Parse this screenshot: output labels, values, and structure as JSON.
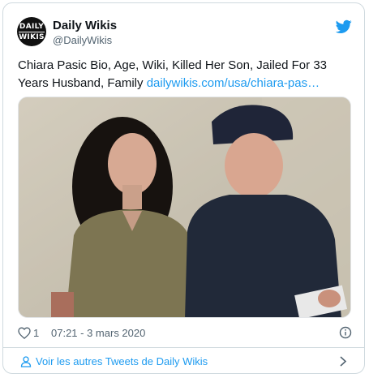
{
  "account": {
    "avatar_text_top": "DAILY",
    "avatar_text_bottom": "WIKIS",
    "display_name": "Daily Wikis",
    "handle": "@DailyWikis"
  },
  "tweet": {
    "text": "Chiara Pasic Bio, Age, Wiki, Killed Her Son, Jailed For 33 Years Husband, Family ",
    "link_text": "dailywikis.com/usa/chiara-pas…",
    "likes": "1",
    "timestamp": "07:21 - 3 mars 2020"
  },
  "footer": {
    "more_tweets_label": "Voir les autres Tweets de Daily Wikis"
  },
  "colors": {
    "accent": "#1d9bf0",
    "muted": "#536471",
    "border": "#cfd9de"
  },
  "icons": [
    "twitter-bird-icon",
    "heart-icon",
    "info-icon",
    "person-icon",
    "chevron-right-icon"
  ]
}
